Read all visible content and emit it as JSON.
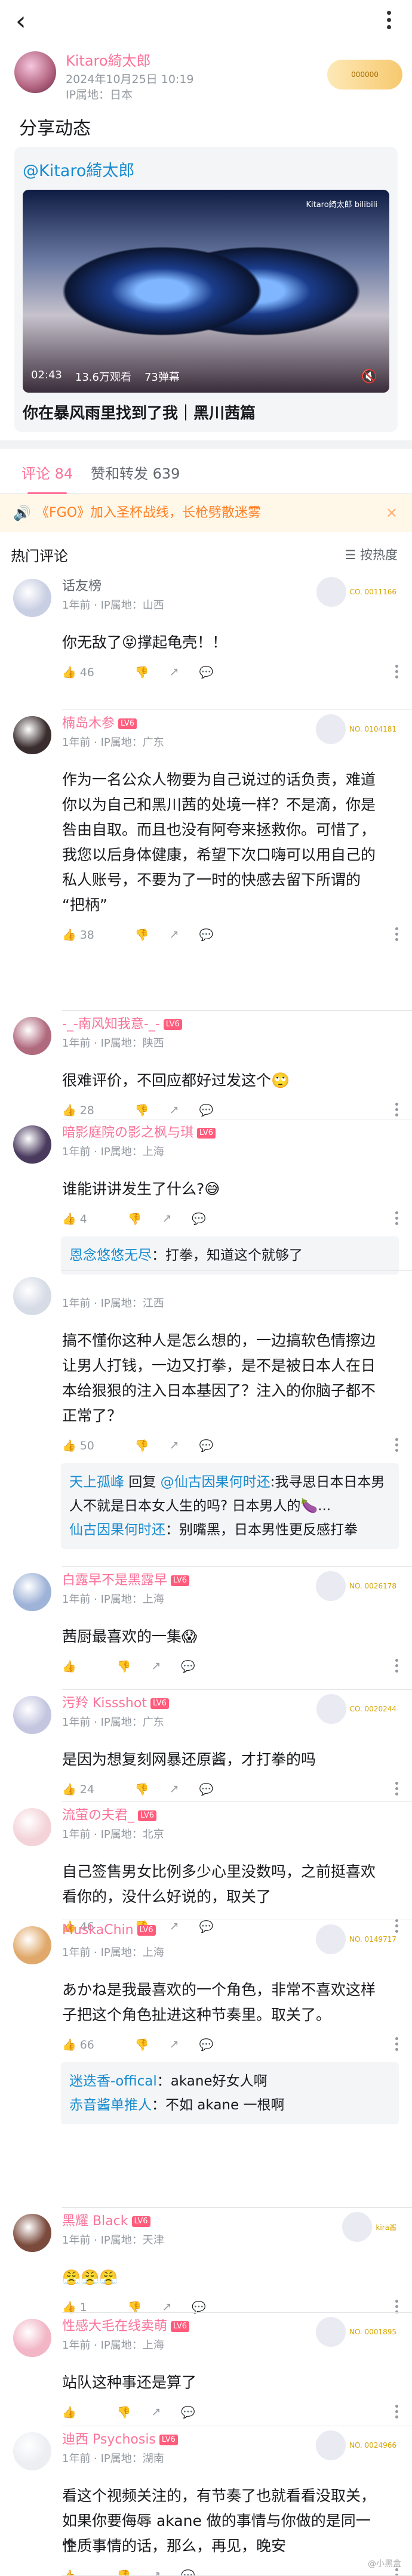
{
  "post": {
    "author": "Kitaro綺太郎",
    "time": "2024年10月25日 10:19",
    "ip": "IP属地：日本",
    "badge": "000000",
    "title": "分享动态",
    "shared_author": "@Kitaro綺太郎",
    "watermark": "Kitaro綺太郎 bilibili",
    "duration": "02:43",
    "views": "13.6万观看",
    "danmaku": "73弹幕",
    "video_title": "你在暴风雨里找到了我｜黑川茜篇"
  },
  "tabs": [
    {
      "label": "评论 84"
    },
    {
      "label": "赞和转发 639"
    }
  ],
  "notice": "《FGO》加入圣杯战线，长枪劈散迷雾",
  "hot_label": "热门评论",
  "sort_label": "按热度",
  "comments": [
    {
      "name": "话友榜",
      "time": "1年前",
      "ip": "IP属地：山西",
      "lines": [
        "你无敌了😝撑起龟壳！！"
      ],
      "likes": "46",
      "fan": "CO. 0011166"
    },
    {
      "name": "楠岛木参",
      "level": "LV6",
      "time": "1年前",
      "ip": "IP属地：广东",
      "lines": [
        "作为一名公众人物要为自己说过的话负责，难道",
        "你以为自己和黑川茜的处境一样？不是滴，你是",
        "咎由自取。而且也没有阿夸来拯救你。可惜了，",
        "我您以后身体健康，希望下次口嗨可以用自己的",
        "私人账号，不要为了一时的快感去留下所谓的",
        "“把柄”"
      ],
      "likes": "38",
      "fan": "NO. 0104181"
    },
    {
      "name": "-_-南风知我意-_-",
      "level": "LV6",
      "time": "1年前",
      "ip": "IP属地：陕西",
      "lines": [
        "很难评价，不回应都好过发这个🙄"
      ],
      "likes": "28"
    },
    {
      "name": "暗影庭院の影之枫与琪",
      "level": "LV6",
      "time": "1年前",
      "ip": "IP属地：上海",
      "lines": [
        "谁能讲讲发生了什么?😅"
      ],
      "likes": "4",
      "reply": {
        "user": "恩念悠悠无尽",
        "text": "：打拳，知道这个就够了"
      }
    },
    {
      "name": "",
      "time": "1年前",
      "ip": "IP属地：江西",
      "lines": [
        "搞不懂你这种人是怎么想的，一边搞软色情擦边",
        "让男人打钱，一边又打拳，是不是被日本人在日",
        "本给狠狠的注入日本基因了？注入的你脑子都不",
        "正常了？"
      ],
      "likes": "50",
      "thread": [
        {
          "user": "天上孤峰",
          "mid": " 回复 ",
          "target": "@仙古因果何时还",
          "text": ":我寻思日本日本男人不就是日本女人生的吗? 日本男人的🍆..."
        },
        {
          "user": "仙古因果何时还",
          "text": "：别嘴黑，日本男性更反感打拳"
        }
      ]
    },
    {
      "name": "白露早不是黑露早",
      "level": "LV6",
      "time": "1年前",
      "ip": "IP属地：上海",
      "lines": [
        "茜厨最喜欢的一集😱"
      ],
      "likes": "",
      "fan": "NO. 0026178"
    },
    {
      "name": "污羚 Kissshot",
      "level": "LV6",
      "time": "1年前",
      "ip": "IP属地：广东",
      "lines": [
        "是因为想复刻网暴还原酱，才打拳的吗"
      ],
      "likes": "24",
      "fan": "CO. 0020244"
    },
    {
      "name": "流萤の夫君_",
      "level": "LV6",
      "time": "1年前",
      "ip": "IP属地：北京",
      "lines": [
        "自己签售男女比例多少心里没数吗，之前挺喜欢",
        "看你的，没什么好说的，取关了"
      ],
      "likes": "46"
    },
    {
      "name": "MuskaChin",
      "level": "LV6",
      "time": "1年前",
      "ip": "IP属地：上海",
      "lines": [
        "あかね是我最喜欢的一个角色，非常不喜欢这样",
        "子把这个角色扯进这种节奏里。取关了。"
      ],
      "likes": "66",
      "fan": "NO. 0149717",
      "thread": [
        {
          "user": "迷迭香-offical",
          "text": "：akane好女人啊"
        },
        {
          "user": "赤音酱单推人",
          "text": "：不如 akane 一根啊"
        }
      ]
    },
    {
      "name": "黑耀 Black",
      "level": "LV6",
      "time": "1年前",
      "ip": "IP属地：天津",
      "lines": [
        "😤😤😤"
      ],
      "likes": "1",
      "fan": "kira酱"
    },
    {
      "name": "性感大毛在线卖萌",
      "level": "LV6",
      "time": "1年前",
      "ip": "IP属地：上海",
      "lines": [
        "站队这种事还是算了"
      ],
      "likes": "",
      "fan": "NO. 0001895"
    },
    {
      "name": "迪西 Psychosis",
      "level": "LV6",
      "time": "1年前",
      "ip": "IP属地：湖南",
      "lines": [
        "看这个视频关注的，有节奏了也就看看没取关，",
        "如果你要侮辱 akane 做的事情与你做的是同一个",
        "性质事情的话，那么，再见，晚安"
      ],
      "likes": "",
      "fan": "NO. 0024966"
    }
  ],
  "footer_watermark": "@小黑盒"
}
